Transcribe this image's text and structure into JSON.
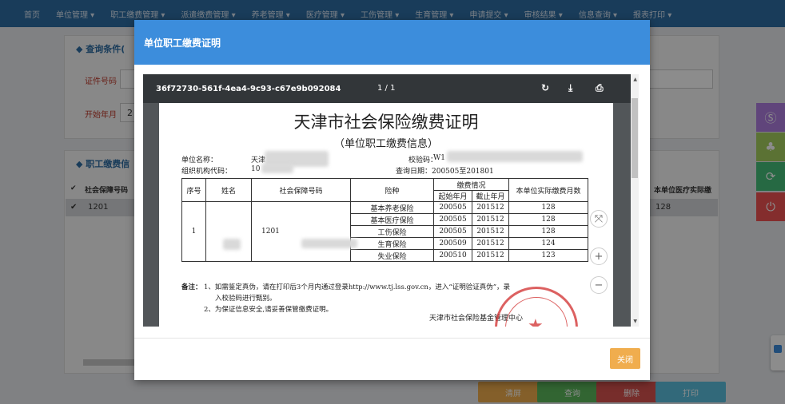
{
  "nav": [
    "首页",
    "单位管理 ▾",
    "职工缴费管理 ▾",
    "派遣缴费管理 ▾",
    "养老管理 ▾",
    "医疗管理 ▾",
    "工伤管理 ▾",
    "生育管理 ▾",
    "申请提交 ▾",
    "审核结果 ▾",
    "信息查询 ▾",
    "报表打印 ▾"
  ],
  "background": {
    "query_panel_title": "◆  查询条件(",
    "field_id_label": "证件号码",
    "field_start_label": "开始年月",
    "field_start_value": "2",
    "result_panel_title": "◆  职工缴费信",
    "col_social_no": "社会保障号码",
    "col_medical": "本单位医疗实际缴",
    "row_social_no": "1201",
    "row_medical": "128",
    "check_mark": "✔",
    "buttons": {
      "reset": "清屏",
      "query": "查询",
      "delete": "删除",
      "print": "打印"
    }
  },
  "modal": {
    "title": "单位职工缴费证明",
    "close_label": "关闭"
  },
  "viewer": {
    "doc_id": "36f72730-561f-4ea4-9c93-c67e9b092084",
    "page_info": "1 / 1",
    "rotate_icon": "↻",
    "download_icon": "⤓",
    "print_icon": "⎙"
  },
  "document": {
    "title": "天津市社会保险缴费证明",
    "subtitle": "（单位职工缴费信息）",
    "unit_name_label": "单位名称：",
    "unit_name_value": "天津",
    "org_code_label": "组织机构代码：",
    "org_code_value": "10",
    "verify_code_label": "校验码：",
    "verify_code_value": "W1",
    "query_date_label": "查询日期：",
    "query_date_value": "200505至201801",
    "table_headers": {
      "seq": "序号",
      "name": "姓名",
      "social_no": "社会保障号码",
      "insurance": "险种",
      "payment": "缴费情况",
      "start": "起始年月",
      "end": "截止年月",
      "months": "本单位实际缴费月数"
    },
    "person": {
      "seq": "1",
      "social_no": "1201"
    },
    "rows": [
      {
        "insurance": "基本养老保险",
        "start": "200505",
        "end": "201512",
        "months": "128"
      },
      {
        "insurance": "基本医疗保险",
        "start": "200505",
        "end": "201512",
        "months": "128"
      },
      {
        "insurance": "工伤保险",
        "start": "200505",
        "end": "201512",
        "months": "128"
      },
      {
        "insurance": "生育保险",
        "start": "200509",
        "end": "201512",
        "months": "124"
      },
      {
        "insurance": "失业保险",
        "start": "200510",
        "end": "201512",
        "months": "123"
      }
    ],
    "remark_label": "备注：",
    "remark_1a": "1、如需鉴定真伪，请在打印后3个月内通过登录http://www.tj.lss.gov.cn，进入“证明验证真伪”，录",
    "remark_1b": "入校验码进行甄别。",
    "remark_2": "2、为保证信息安全,请妥善保管缴费证明。",
    "issuer": "天津市社会保险基金管理中心",
    "seal_text": "天津市社会保险基金管理中心"
  },
  "zoom": {
    "fit": "⤧",
    "in": "+",
    "out": "−"
  },
  "side": {
    "icon1": "Ⓢ",
    "icon2": "♣",
    "icon3": "⟳",
    "icon4": "⏻"
  },
  "colors": {
    "nav": "#2e6da4",
    "modal_header": "#3c8ddc",
    "close_btn": "#f0ad4e",
    "seal": "#d43a3a"
  }
}
